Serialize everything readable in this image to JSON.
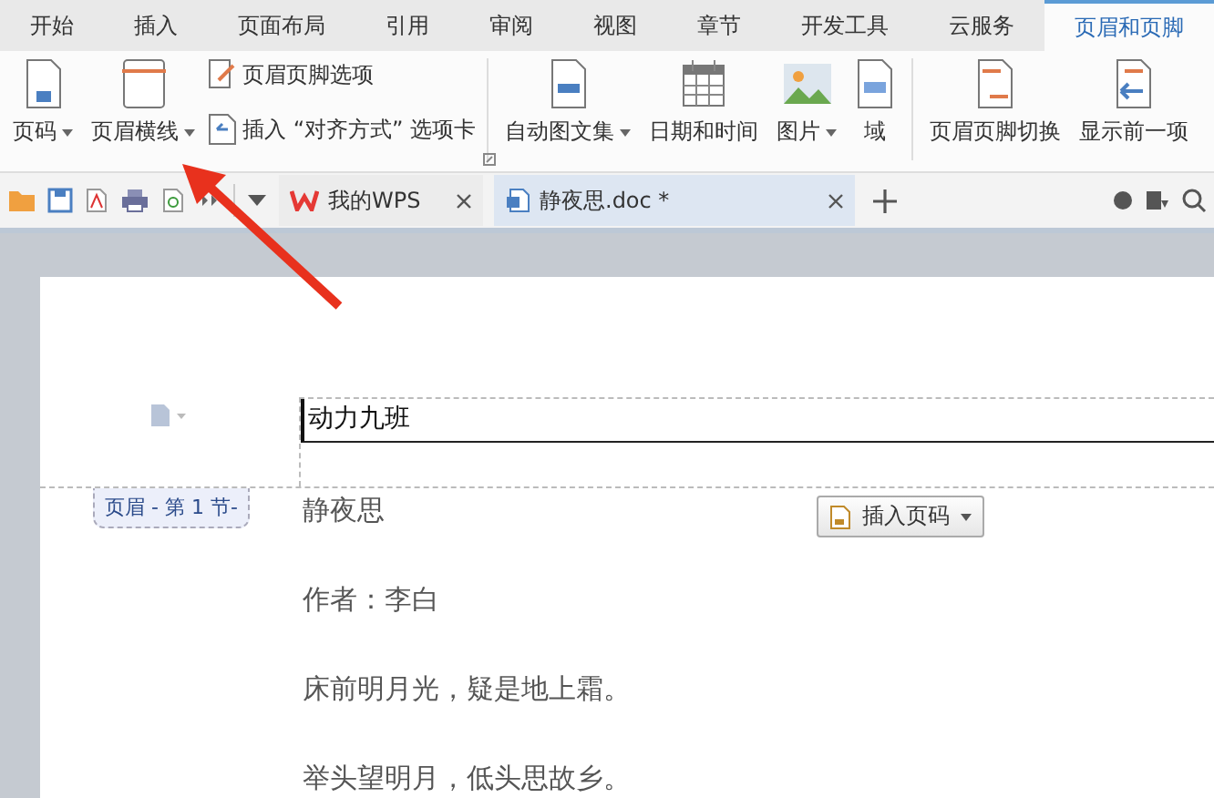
{
  "menu_tabs": [
    {
      "label": "开始",
      "selected": false
    },
    {
      "label": "插入",
      "selected": false
    },
    {
      "label": "页面布局",
      "selected": false
    },
    {
      "label": "引用",
      "selected": false
    },
    {
      "label": "审阅",
      "selected": false
    },
    {
      "label": "视图",
      "selected": false
    },
    {
      "label": "章节",
      "selected": false
    },
    {
      "label": "开发工具",
      "selected": false
    },
    {
      "label": "云服务",
      "selected": false
    },
    {
      "label": "页眉和页脚",
      "selected": true
    }
  ],
  "ribbon": {
    "groups": [
      {
        "buttons": [
          {
            "kind": "large",
            "label": "页码",
            "dropdown": true
          },
          {
            "kind": "large",
            "label": "页眉横线",
            "dropdown": true
          },
          {
            "kind": "small",
            "label": "页眉页脚选项",
            "dropdown": false
          },
          {
            "kind": "small",
            "label": "插入 “对齐方式” 选项卡",
            "dropdown": false
          }
        ]
      },
      {
        "buttons": [
          {
            "kind": "large",
            "label": "自动图文集",
            "dropdown": true
          },
          {
            "kind": "large",
            "label": "日期和时间",
            "dropdown": false
          },
          {
            "kind": "large",
            "label": "图片",
            "dropdown": true
          },
          {
            "kind": "large",
            "label": "域",
            "dropdown": false
          }
        ]
      },
      {
        "buttons": [
          {
            "kind": "large",
            "label": "页眉页脚切换",
            "dropdown": false
          },
          {
            "kind": "large",
            "label": "显示前一项",
            "dropdown": false
          }
        ]
      }
    ]
  },
  "doc_tabs": [
    {
      "label": "我的WPS",
      "selected": false
    },
    {
      "label": "静夜思.doc *",
      "selected": true
    }
  ],
  "document": {
    "header_text": "动力九班",
    "section_label": "页眉 - 第 1 节-",
    "insert_button": "插入页码",
    "lines": [
      "静夜思",
      "作者：李白",
      "床前明月光，疑是地上霜。",
      "举头望明月，低头思故乡。"
    ]
  }
}
